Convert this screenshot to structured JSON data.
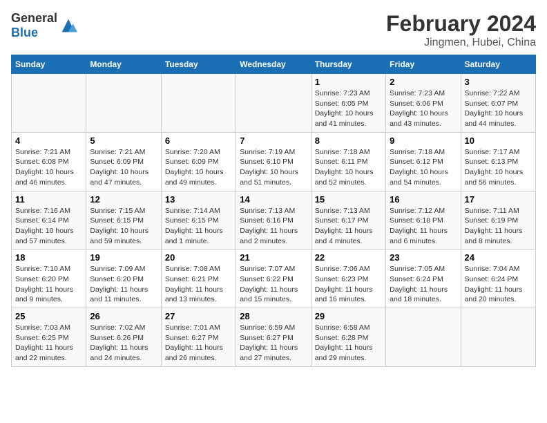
{
  "header": {
    "logo_general": "General",
    "logo_blue": "Blue",
    "title": "February 2024",
    "subtitle": "Jingmen, Hubei, China"
  },
  "days_of_week": [
    "Sunday",
    "Monday",
    "Tuesday",
    "Wednesday",
    "Thursday",
    "Friday",
    "Saturday"
  ],
  "weeks": [
    [
      {
        "day": "",
        "sunrise": "",
        "sunset": "",
        "daylight": ""
      },
      {
        "day": "",
        "sunrise": "",
        "sunset": "",
        "daylight": ""
      },
      {
        "day": "",
        "sunrise": "",
        "sunset": "",
        "daylight": ""
      },
      {
        "day": "",
        "sunrise": "",
        "sunset": "",
        "daylight": ""
      },
      {
        "day": "1",
        "sunrise": "7:23 AM",
        "sunset": "6:05 PM",
        "daylight": "10 hours and 41 minutes."
      },
      {
        "day": "2",
        "sunrise": "7:23 AM",
        "sunset": "6:06 PM",
        "daylight": "10 hours and 43 minutes."
      },
      {
        "day": "3",
        "sunrise": "7:22 AM",
        "sunset": "6:07 PM",
        "daylight": "10 hours and 44 minutes."
      }
    ],
    [
      {
        "day": "4",
        "sunrise": "7:21 AM",
        "sunset": "6:08 PM",
        "daylight": "10 hours and 46 minutes."
      },
      {
        "day": "5",
        "sunrise": "7:21 AM",
        "sunset": "6:09 PM",
        "daylight": "10 hours and 47 minutes."
      },
      {
        "day": "6",
        "sunrise": "7:20 AM",
        "sunset": "6:09 PM",
        "daylight": "10 hours and 49 minutes."
      },
      {
        "day": "7",
        "sunrise": "7:19 AM",
        "sunset": "6:10 PM",
        "daylight": "10 hours and 51 minutes."
      },
      {
        "day": "8",
        "sunrise": "7:18 AM",
        "sunset": "6:11 PM",
        "daylight": "10 hours and 52 minutes."
      },
      {
        "day": "9",
        "sunrise": "7:18 AM",
        "sunset": "6:12 PM",
        "daylight": "10 hours and 54 minutes."
      },
      {
        "day": "10",
        "sunrise": "7:17 AM",
        "sunset": "6:13 PM",
        "daylight": "10 hours and 56 minutes."
      }
    ],
    [
      {
        "day": "11",
        "sunrise": "7:16 AM",
        "sunset": "6:14 PM",
        "daylight": "10 hours and 57 minutes."
      },
      {
        "day": "12",
        "sunrise": "7:15 AM",
        "sunset": "6:15 PM",
        "daylight": "10 hours and 59 minutes."
      },
      {
        "day": "13",
        "sunrise": "7:14 AM",
        "sunset": "6:15 PM",
        "daylight": "11 hours and 1 minute."
      },
      {
        "day": "14",
        "sunrise": "7:13 AM",
        "sunset": "6:16 PM",
        "daylight": "11 hours and 2 minutes."
      },
      {
        "day": "15",
        "sunrise": "7:13 AM",
        "sunset": "6:17 PM",
        "daylight": "11 hours and 4 minutes."
      },
      {
        "day": "16",
        "sunrise": "7:12 AM",
        "sunset": "6:18 PM",
        "daylight": "11 hours and 6 minutes."
      },
      {
        "day": "17",
        "sunrise": "7:11 AM",
        "sunset": "6:19 PM",
        "daylight": "11 hours and 8 minutes."
      }
    ],
    [
      {
        "day": "18",
        "sunrise": "7:10 AM",
        "sunset": "6:20 PM",
        "daylight": "11 hours and 9 minutes."
      },
      {
        "day": "19",
        "sunrise": "7:09 AM",
        "sunset": "6:20 PM",
        "daylight": "11 hours and 11 minutes."
      },
      {
        "day": "20",
        "sunrise": "7:08 AM",
        "sunset": "6:21 PM",
        "daylight": "11 hours and 13 minutes."
      },
      {
        "day": "21",
        "sunrise": "7:07 AM",
        "sunset": "6:22 PM",
        "daylight": "11 hours and 15 minutes."
      },
      {
        "day": "22",
        "sunrise": "7:06 AM",
        "sunset": "6:23 PM",
        "daylight": "11 hours and 16 minutes."
      },
      {
        "day": "23",
        "sunrise": "7:05 AM",
        "sunset": "6:24 PM",
        "daylight": "11 hours and 18 minutes."
      },
      {
        "day": "24",
        "sunrise": "7:04 AM",
        "sunset": "6:24 PM",
        "daylight": "11 hours and 20 minutes."
      }
    ],
    [
      {
        "day": "25",
        "sunrise": "7:03 AM",
        "sunset": "6:25 PM",
        "daylight": "11 hours and 22 minutes."
      },
      {
        "day": "26",
        "sunrise": "7:02 AM",
        "sunset": "6:26 PM",
        "daylight": "11 hours and 24 minutes."
      },
      {
        "day": "27",
        "sunrise": "7:01 AM",
        "sunset": "6:27 PM",
        "daylight": "11 hours and 26 minutes."
      },
      {
        "day": "28",
        "sunrise": "6:59 AM",
        "sunset": "6:27 PM",
        "daylight": "11 hours and 27 minutes."
      },
      {
        "day": "29",
        "sunrise": "6:58 AM",
        "sunset": "6:28 PM",
        "daylight": "11 hours and 29 minutes."
      },
      {
        "day": "",
        "sunrise": "",
        "sunset": "",
        "daylight": ""
      },
      {
        "day": "",
        "sunrise": "",
        "sunset": "",
        "daylight": ""
      }
    ]
  ],
  "labels": {
    "sunrise": "Sunrise:",
    "sunset": "Sunset:",
    "daylight": "Daylight:"
  }
}
